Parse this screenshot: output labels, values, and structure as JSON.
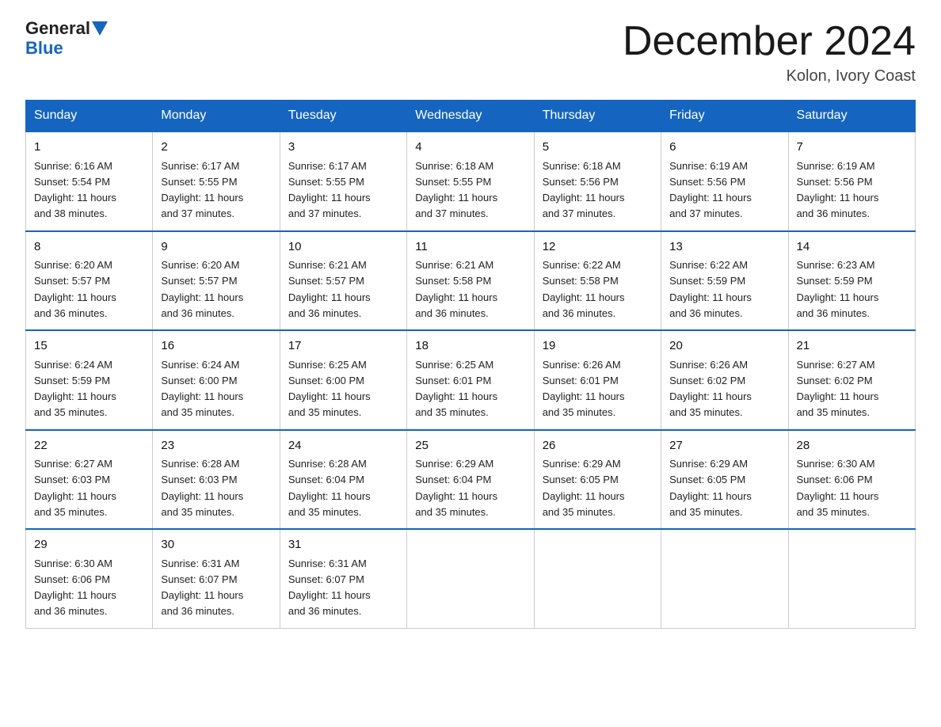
{
  "logo": {
    "general": "General",
    "blue": "Blue"
  },
  "header": {
    "month": "December 2024",
    "location": "Kolon, Ivory Coast"
  },
  "weekdays": [
    "Sunday",
    "Monday",
    "Tuesday",
    "Wednesday",
    "Thursday",
    "Friday",
    "Saturday"
  ],
  "weeks": [
    [
      {
        "day": "1",
        "sunrise": "6:16 AM",
        "sunset": "5:54 PM",
        "daylight": "11 hours and 38 minutes."
      },
      {
        "day": "2",
        "sunrise": "6:17 AM",
        "sunset": "5:55 PM",
        "daylight": "11 hours and 37 minutes."
      },
      {
        "day": "3",
        "sunrise": "6:17 AM",
        "sunset": "5:55 PM",
        "daylight": "11 hours and 37 minutes."
      },
      {
        "day": "4",
        "sunrise": "6:18 AM",
        "sunset": "5:55 PM",
        "daylight": "11 hours and 37 minutes."
      },
      {
        "day": "5",
        "sunrise": "6:18 AM",
        "sunset": "5:56 PM",
        "daylight": "11 hours and 37 minutes."
      },
      {
        "day": "6",
        "sunrise": "6:19 AM",
        "sunset": "5:56 PM",
        "daylight": "11 hours and 37 minutes."
      },
      {
        "day": "7",
        "sunrise": "6:19 AM",
        "sunset": "5:56 PM",
        "daylight": "11 hours and 36 minutes."
      }
    ],
    [
      {
        "day": "8",
        "sunrise": "6:20 AM",
        "sunset": "5:57 PM",
        "daylight": "11 hours and 36 minutes."
      },
      {
        "day": "9",
        "sunrise": "6:20 AM",
        "sunset": "5:57 PM",
        "daylight": "11 hours and 36 minutes."
      },
      {
        "day": "10",
        "sunrise": "6:21 AM",
        "sunset": "5:57 PM",
        "daylight": "11 hours and 36 minutes."
      },
      {
        "day": "11",
        "sunrise": "6:21 AM",
        "sunset": "5:58 PM",
        "daylight": "11 hours and 36 minutes."
      },
      {
        "day": "12",
        "sunrise": "6:22 AM",
        "sunset": "5:58 PM",
        "daylight": "11 hours and 36 minutes."
      },
      {
        "day": "13",
        "sunrise": "6:22 AM",
        "sunset": "5:59 PM",
        "daylight": "11 hours and 36 minutes."
      },
      {
        "day": "14",
        "sunrise": "6:23 AM",
        "sunset": "5:59 PM",
        "daylight": "11 hours and 36 minutes."
      }
    ],
    [
      {
        "day": "15",
        "sunrise": "6:24 AM",
        "sunset": "5:59 PM",
        "daylight": "11 hours and 35 minutes."
      },
      {
        "day": "16",
        "sunrise": "6:24 AM",
        "sunset": "6:00 PM",
        "daylight": "11 hours and 35 minutes."
      },
      {
        "day": "17",
        "sunrise": "6:25 AM",
        "sunset": "6:00 PM",
        "daylight": "11 hours and 35 minutes."
      },
      {
        "day": "18",
        "sunrise": "6:25 AM",
        "sunset": "6:01 PM",
        "daylight": "11 hours and 35 minutes."
      },
      {
        "day": "19",
        "sunrise": "6:26 AM",
        "sunset": "6:01 PM",
        "daylight": "11 hours and 35 minutes."
      },
      {
        "day": "20",
        "sunrise": "6:26 AM",
        "sunset": "6:02 PM",
        "daylight": "11 hours and 35 minutes."
      },
      {
        "day": "21",
        "sunrise": "6:27 AM",
        "sunset": "6:02 PM",
        "daylight": "11 hours and 35 minutes."
      }
    ],
    [
      {
        "day": "22",
        "sunrise": "6:27 AM",
        "sunset": "6:03 PM",
        "daylight": "11 hours and 35 minutes."
      },
      {
        "day": "23",
        "sunrise": "6:28 AM",
        "sunset": "6:03 PM",
        "daylight": "11 hours and 35 minutes."
      },
      {
        "day": "24",
        "sunrise": "6:28 AM",
        "sunset": "6:04 PM",
        "daylight": "11 hours and 35 minutes."
      },
      {
        "day": "25",
        "sunrise": "6:29 AM",
        "sunset": "6:04 PM",
        "daylight": "11 hours and 35 minutes."
      },
      {
        "day": "26",
        "sunrise": "6:29 AM",
        "sunset": "6:05 PM",
        "daylight": "11 hours and 35 minutes."
      },
      {
        "day": "27",
        "sunrise": "6:29 AM",
        "sunset": "6:05 PM",
        "daylight": "11 hours and 35 minutes."
      },
      {
        "day": "28",
        "sunrise": "6:30 AM",
        "sunset": "6:06 PM",
        "daylight": "11 hours and 35 minutes."
      }
    ],
    [
      {
        "day": "29",
        "sunrise": "6:30 AM",
        "sunset": "6:06 PM",
        "daylight": "11 hours and 36 minutes."
      },
      {
        "day": "30",
        "sunrise": "6:31 AM",
        "sunset": "6:07 PM",
        "daylight": "11 hours and 36 minutes."
      },
      {
        "day": "31",
        "sunrise": "6:31 AM",
        "sunset": "6:07 PM",
        "daylight": "11 hours and 36 minutes."
      },
      null,
      null,
      null,
      null
    ]
  ],
  "labels": {
    "sunrise": "Sunrise:",
    "sunset": "Sunset:",
    "daylight": "Daylight:"
  }
}
